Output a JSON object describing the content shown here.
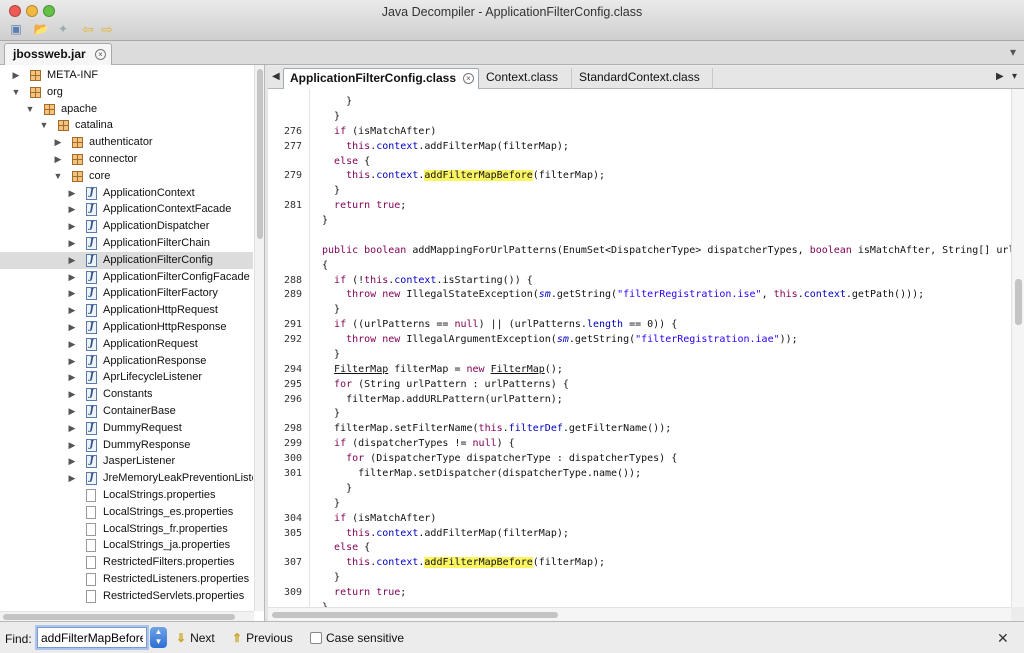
{
  "window": {
    "title": "Java Decompiler - ApplicationFilterConfig.class"
  },
  "toolbar": {
    "icons": [
      "open-file-icon",
      "open-type-icon",
      "back-icon",
      "forward-icon"
    ]
  },
  "document_tab": {
    "label": "jbossweb.jar"
  },
  "tree": {
    "selected": "ApplicationFilterConfig",
    "rows": [
      {
        "label": "META-INF",
        "indent": 0,
        "kind": "package",
        "arrow": "collapsed"
      },
      {
        "label": "org",
        "indent": 0,
        "kind": "package",
        "arrow": "expanded"
      },
      {
        "label": "apache",
        "indent": 1,
        "kind": "package",
        "arrow": "expanded"
      },
      {
        "label": "catalina",
        "indent": 2,
        "kind": "package",
        "arrow": "expanded"
      },
      {
        "label": "authenticator",
        "indent": 3,
        "kind": "package",
        "arrow": "collapsed"
      },
      {
        "label": "connector",
        "indent": 3,
        "kind": "package",
        "arrow": "collapsed"
      },
      {
        "label": "core",
        "indent": 3,
        "kind": "package",
        "arrow": "expanded"
      },
      {
        "label": "ApplicationContext",
        "indent": 4,
        "kind": "class",
        "arrow": "collapsed"
      },
      {
        "label": "ApplicationContextFacade",
        "indent": 4,
        "kind": "class",
        "arrow": "collapsed"
      },
      {
        "label": "ApplicationDispatcher",
        "indent": 4,
        "kind": "class",
        "arrow": "collapsed"
      },
      {
        "label": "ApplicationFilterChain",
        "indent": 4,
        "kind": "class",
        "arrow": "collapsed"
      },
      {
        "label": "ApplicationFilterConfig",
        "indent": 4,
        "kind": "class",
        "arrow": "collapsed"
      },
      {
        "label": "ApplicationFilterConfigFacade",
        "indent": 4,
        "kind": "class",
        "arrow": "collapsed"
      },
      {
        "label": "ApplicationFilterFactory",
        "indent": 4,
        "kind": "class",
        "arrow": "collapsed"
      },
      {
        "label": "ApplicationHttpRequest",
        "indent": 4,
        "kind": "class",
        "arrow": "collapsed"
      },
      {
        "label": "ApplicationHttpResponse",
        "indent": 4,
        "kind": "class",
        "arrow": "collapsed"
      },
      {
        "label": "ApplicationRequest",
        "indent": 4,
        "kind": "class",
        "arrow": "collapsed"
      },
      {
        "label": "ApplicationResponse",
        "indent": 4,
        "kind": "class",
        "arrow": "collapsed"
      },
      {
        "label": "AprLifecycleListener",
        "indent": 4,
        "kind": "class",
        "arrow": "collapsed"
      },
      {
        "label": "Constants",
        "indent": 4,
        "kind": "class",
        "arrow": "collapsed"
      },
      {
        "label": "ContainerBase",
        "indent": 4,
        "kind": "class",
        "arrow": "collapsed"
      },
      {
        "label": "DummyRequest",
        "indent": 4,
        "kind": "class",
        "arrow": "collapsed"
      },
      {
        "label": "DummyResponse",
        "indent": 4,
        "kind": "class",
        "arrow": "collapsed"
      },
      {
        "label": "JasperListener",
        "indent": 4,
        "kind": "class",
        "arrow": "collapsed"
      },
      {
        "label": "JreMemoryLeakPreventionListener",
        "indent": 4,
        "kind": "class",
        "arrow": "collapsed"
      },
      {
        "label": "LocalStrings.properties",
        "indent": 4,
        "kind": "file",
        "arrow": "none"
      },
      {
        "label": "LocalStrings_es.properties",
        "indent": 4,
        "kind": "file",
        "arrow": "none"
      },
      {
        "label": "LocalStrings_fr.properties",
        "indent": 4,
        "kind": "file",
        "arrow": "none"
      },
      {
        "label": "LocalStrings_ja.properties",
        "indent": 4,
        "kind": "file",
        "arrow": "none"
      },
      {
        "label": "RestrictedFilters.properties",
        "indent": 4,
        "kind": "file",
        "arrow": "none"
      },
      {
        "label": "RestrictedListeners.properties",
        "indent": 4,
        "kind": "file",
        "arrow": "none"
      },
      {
        "label": "RestrictedServlets.properties",
        "indent": 4,
        "kind": "file",
        "arrow": "none"
      }
    ]
  },
  "editor": {
    "tabs": [
      {
        "label": "ApplicationFilterConfig.class",
        "active": true,
        "closable": true
      },
      {
        "label": "Context.class",
        "active": false,
        "closable": false
      },
      {
        "label": "StandardContext.class",
        "active": false,
        "closable": false
      }
    ],
    "highlight_term": "addFilterMapBefore",
    "lines": [
      {
        "n": "",
        "code": "    }"
      },
      {
        "n": "",
        "code": "  }"
      },
      {
        "n": "276",
        "code": "  if (isMatchAfter)"
      },
      {
        "n": "277",
        "code": "    this.context.addFilterMap(filterMap);"
      },
      {
        "n": "",
        "code": "  else {"
      },
      {
        "n": "279",
        "code": "    this.context.addFilterMapBefore(filterMap);"
      },
      {
        "n": "",
        "code": "  }"
      },
      {
        "n": "281",
        "code": "  return true;"
      },
      {
        "n": "",
        "code": "}"
      },
      {
        "n": "",
        "code": ""
      },
      {
        "n": "",
        "code": "public boolean addMappingForUrlPatterns(EnumSet<DispatcherType> dispatcherTypes, boolean isMatchAfter, String[] urlPat"
      },
      {
        "n": "",
        "code": "{"
      },
      {
        "n": "288",
        "code": "  if (!this.context.isStarting()) {"
      },
      {
        "n": "289",
        "code": "    throw new IllegalStateException(sm.getString(\"filterRegistration.ise\", this.context.getPath()));"
      },
      {
        "n": "",
        "code": "  }"
      },
      {
        "n": "291",
        "code": "  if ((urlPatterns == null) || (urlPatterns.length == 0)) {"
      },
      {
        "n": "292",
        "code": "    throw new IllegalArgumentException(sm.getString(\"filterRegistration.iae\"));"
      },
      {
        "n": "",
        "code": "  }"
      },
      {
        "n": "294",
        "code": "  FilterMap filterMap = new FilterMap();"
      },
      {
        "n": "295",
        "code": "  for (String urlPattern : urlPatterns) {"
      },
      {
        "n": "296",
        "code": "    filterMap.addURLPattern(urlPattern);"
      },
      {
        "n": "",
        "code": "  }"
      },
      {
        "n": "298",
        "code": "  filterMap.setFilterName(this.filterDef.getFilterName());"
      },
      {
        "n": "299",
        "code": "  if (dispatcherTypes != null) {"
      },
      {
        "n": "300",
        "code": "    for (DispatcherType dispatcherType : dispatcherTypes) {"
      },
      {
        "n": "301",
        "code": "      filterMap.setDispatcher(dispatcherType.name());"
      },
      {
        "n": "",
        "code": "    }"
      },
      {
        "n": "",
        "code": "  }"
      },
      {
        "n": "304",
        "code": "  if (isMatchAfter)"
      },
      {
        "n": "305",
        "code": "    this.context.addFilterMap(filterMap);"
      },
      {
        "n": "",
        "code": "  else {"
      },
      {
        "n": "307",
        "code": "    this.context.addFilterMapBefore(filterMap);"
      },
      {
        "n": "",
        "code": "  }"
      },
      {
        "n": "309",
        "code": "  return true;"
      },
      {
        "n": "",
        "code": "}"
      }
    ]
  },
  "findbar": {
    "label": "Find:",
    "value": "addFilterMapBefore",
    "next_label": "Next",
    "previous_label": "Previous",
    "case_label": "Case sensitive",
    "case_checked": false
  }
}
